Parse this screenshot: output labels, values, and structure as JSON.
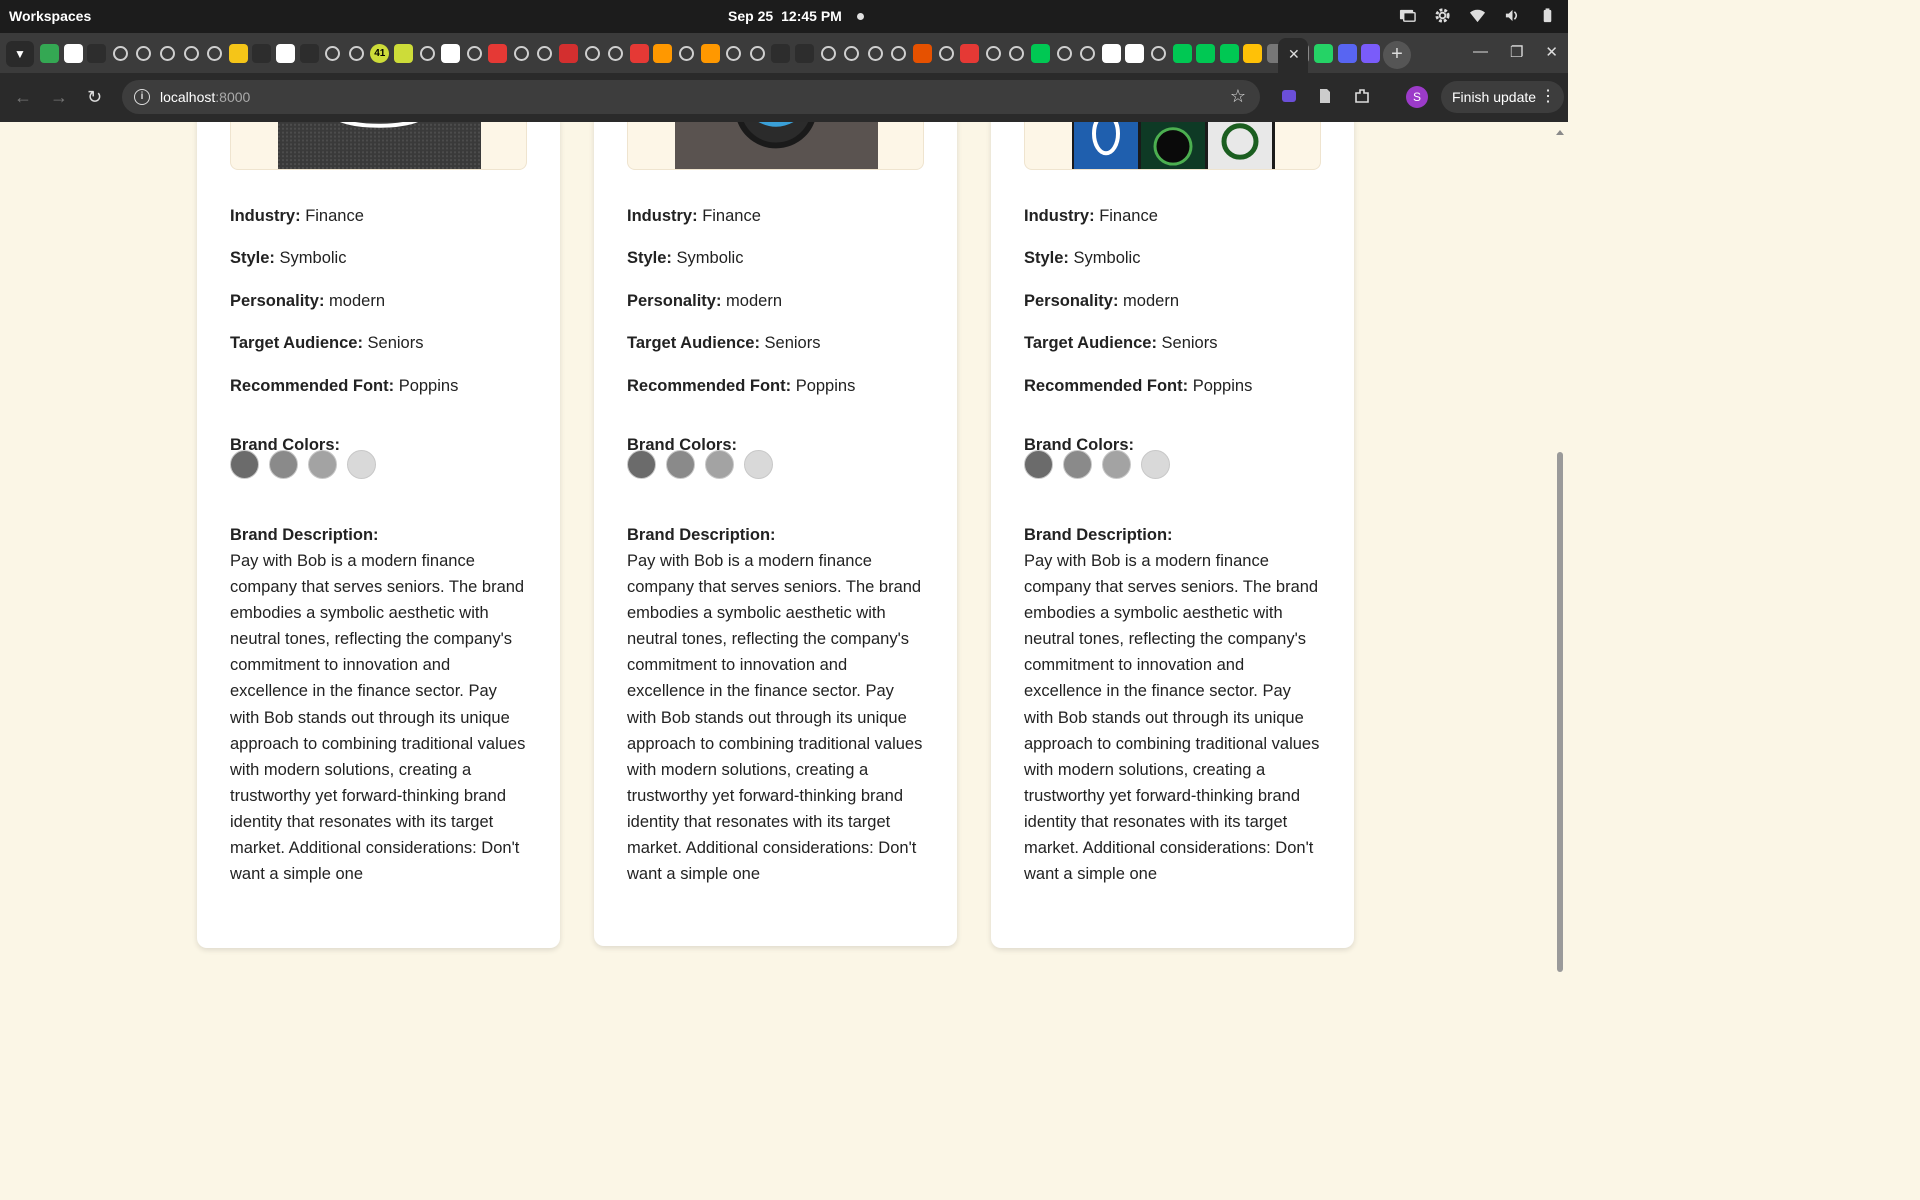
{
  "os": {
    "workspaces_label": "Workspaces",
    "date": "Sep 25",
    "time": "12:45 PM",
    "tray_icons": [
      "screen-share-icon",
      "gear-icon",
      "wifi-icon",
      "volume-icon",
      "battery-icon"
    ]
  },
  "browser": {
    "url_host": "localhost",
    "url_port": ":8000",
    "finish_update_label": "Finish update",
    "profile_initial": "S",
    "active_tab_close": "✕",
    "new_tab": "+",
    "favicon_badge": "41"
  },
  "cards": [
    {
      "industry_label": "Industry:",
      "industry": "Finance",
      "style_label": "Style:",
      "style": "Symbolic",
      "personality_label": "Personality:",
      "personality": "modern",
      "audience_label": "Target Audience:",
      "audience": "Seniors",
      "font_label": "Recommended Font:",
      "font": "Poppins",
      "colors_label": "Brand Colors:",
      "colors": [
        "#6b6b6b",
        "#8a8a8a",
        "#a3a3a3",
        "#d9d9d9"
      ],
      "description_label": "Brand Description:",
      "description": "Pay with Bob is a modern finance company that serves seniors. The brand embodies a symbolic aesthetic with neutral tones, reflecting the company's commitment to innovation and excellence in the finance sector. Pay with Bob stands out through its unique approach to combining traditional values with modern solutions, creating a trustworthy yet forward-thinking brand identity that resonates with its target market. Additional considerations: Don't want a simple one"
    },
    {
      "industry_label": "Industry:",
      "industry": "Finance",
      "style_label": "Style:",
      "style": "Symbolic",
      "personality_label": "Personality:",
      "personality": "modern",
      "audience_label": "Target Audience:",
      "audience": "Seniors",
      "font_label": "Recommended Font:",
      "font": "Poppins",
      "colors_label": "Brand Colors:",
      "colors": [
        "#6b6b6b",
        "#8a8a8a",
        "#a3a3a3",
        "#d9d9d9"
      ],
      "description_label": "Brand Description:",
      "description": "Pay with Bob is a modern finance company that serves seniors. The brand embodies a symbolic aesthetic with neutral tones, reflecting the company's commitment to innovation and excellence in the finance sector. Pay with Bob stands out through its unique approach to combining traditional values with modern solutions, creating a trustworthy yet forward-thinking brand identity that resonates with its target market. Additional considerations: Don't want a simple one"
    },
    {
      "industry_label": "Industry:",
      "industry": "Finance",
      "style_label": "Style:",
      "style": "Symbolic",
      "personality_label": "Personality:",
      "personality": "modern",
      "audience_label": "Target Audience:",
      "audience": "Seniors",
      "font_label": "Recommended Font:",
      "font": "Poppins",
      "colors_label": "Brand Colors:",
      "colors": [
        "#6b6b6b",
        "#8a8a8a",
        "#a3a3a3",
        "#d9d9d9"
      ],
      "description_label": "Brand Description:",
      "description": "Pay with Bob is a modern finance company that serves seniors. The brand embodies a symbolic aesthetic with neutral tones, reflecting the company's commitment to innovation and excellence in the finance sector. Pay with Bob stands out through its unique approach to combining traditional values with modern solutions, creating a trustworthy yet forward-thinking brand identity that resonates with its target market. Additional considerations: Don't want a simple one"
    }
  ]
}
